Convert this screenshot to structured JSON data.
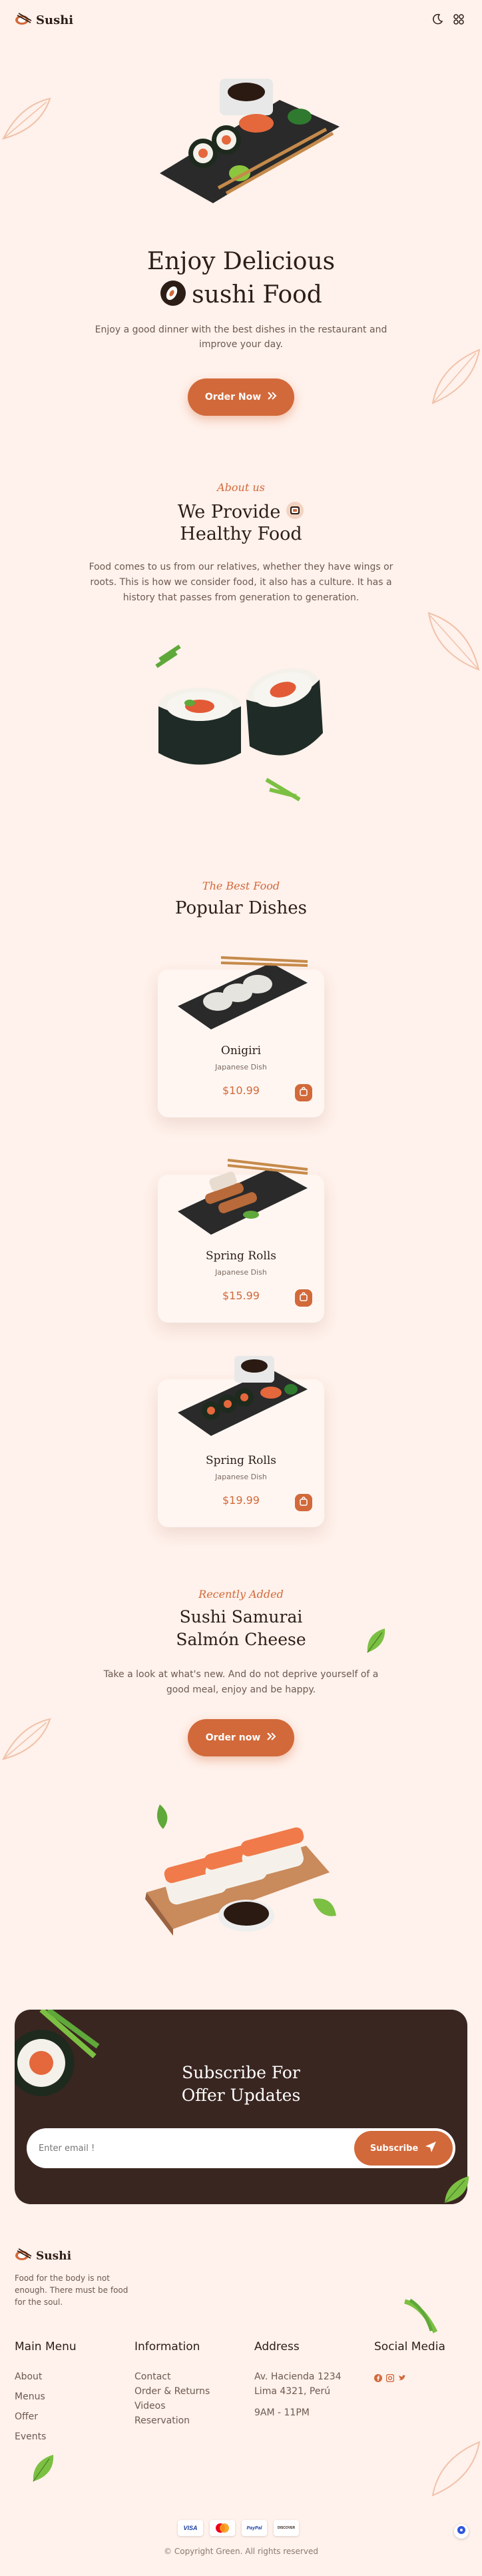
{
  "header": {
    "brand": "Sushi",
    "icons": [
      "moon-icon",
      "grid-icon"
    ]
  },
  "hero": {
    "title_line1": "Enjoy Delicious",
    "title_line2": "sushi Food",
    "description": "Enjoy a good dinner with the best dishes in the restaurant and improve your day.",
    "button_label": "Order Now"
  },
  "about": {
    "script_title": "About us",
    "title_line1": "We Provide",
    "title_line2": "Healthy Food",
    "description": "Food comes to us from our relatives, whether they have wings or roots. This is how we consider food, it also has a culture. It has a history that passes from generation to generation."
  },
  "popular": {
    "script_title": "The Best Food",
    "title": "Popular Dishes",
    "items": [
      {
        "name": "Onigiri",
        "sub": "Japanese Dish",
        "price": "$10.99"
      },
      {
        "name": "Spring Rolls",
        "sub": "Japanese Dish",
        "price": "$15.99"
      },
      {
        "name": "Spring Rolls",
        "sub": "Japanese Dish",
        "price": "$19.99"
      }
    ]
  },
  "recent": {
    "script_title": "Recently Added",
    "title_line1": "Sushi Samurai",
    "title_line2": "Salmón Cheese",
    "description": "Take a look at what's new. And do not deprive yourself of a good meal, enjoy and be happy.",
    "button_label": "Order now"
  },
  "subscribe": {
    "title_line1": "Subscribe For",
    "title_line2": "Offer Updates",
    "placeholder": "Enter email !",
    "button_label": "Subscribe"
  },
  "footer": {
    "brand": "Sushi",
    "tagline": "Food for the body is not enough. There must be food for the soul.",
    "main_menu": {
      "heading": "Main Menu",
      "links": [
        "About",
        "Menus",
        "Offer",
        "Events"
      ]
    },
    "information": {
      "heading": "Information",
      "links": [
        "Contact",
        "Order & Returns",
        "Videos",
        "Reservation"
      ]
    },
    "address": {
      "heading": "Address",
      "lines": [
        "Av. Hacienda 1234",
        "Lima 4321, Perú",
        "9AM - 11PM"
      ]
    },
    "social": {
      "heading": "Social Media",
      "icons": [
        "facebook-icon",
        "instagram-icon",
        "twitter-icon"
      ]
    },
    "payments": [
      "VISA",
      "Mastercard",
      "PayPal",
      "DISCOVER"
    ],
    "copyright": "© Copyright Green. All rights reserved"
  },
  "colors": {
    "background": "#fff1eb",
    "accent": "#d2693a",
    "dark": "#2c1d16"
  }
}
